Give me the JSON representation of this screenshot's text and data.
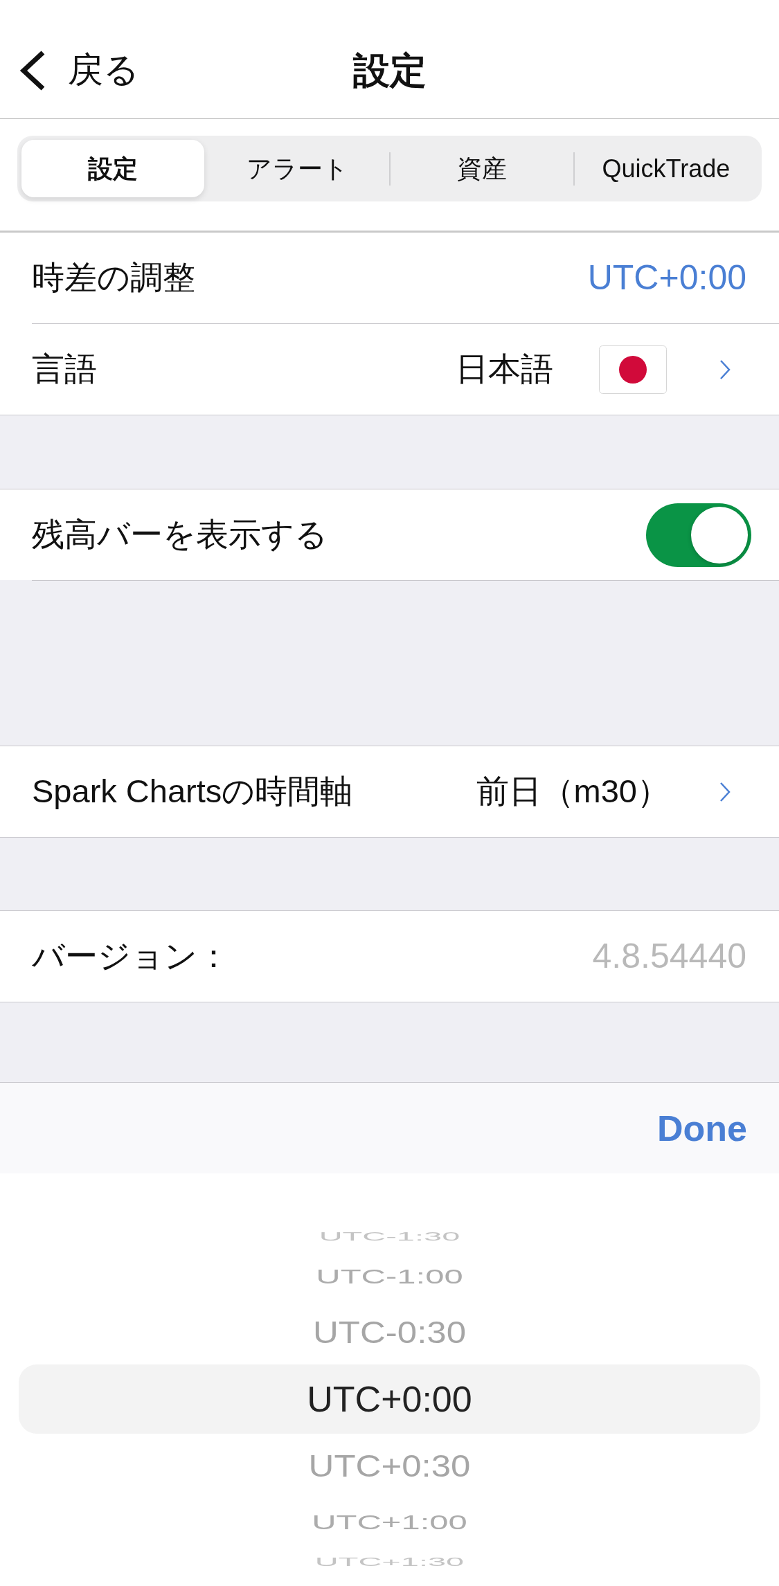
{
  "nav_bar": {
    "back_label": "戻る",
    "title": "設定"
  },
  "tabs": [
    {
      "label": "設定",
      "selected": true
    },
    {
      "label": "アラート",
      "selected": false
    },
    {
      "label": "資産",
      "selected": false
    },
    {
      "label": "QuickTrade",
      "selected": false
    }
  ],
  "sections": [
    {
      "rows": [
        {
          "kind": "value",
          "label": "時差の調整",
          "value": "UTC+0:00"
        },
        {
          "kind": "language",
          "label": "言語",
          "value": "日本語"
        }
      ]
    },
    {
      "rows": [
        {
          "kind": "toggle",
          "label": "残高バーを表示する",
          "on": true
        }
      ]
    },
    {
      "rows": [
        {
          "kind": "disclosure",
          "label": "Spark Chartsの時間軸",
          "value": "前日（m30）"
        }
      ]
    },
    {
      "rows": [
        {
          "kind": "info",
          "label": "バージョン：",
          "value": "4.8.54440"
        }
      ]
    }
  ],
  "picker": {
    "done_label": "Done",
    "options": [
      {
        "label": "UTC-1:30",
        "selected": false
      },
      {
        "label": "UTC-1:00",
        "selected": false
      },
      {
        "label": "UTC-0:30",
        "selected": false
      },
      {
        "label": "UTC+0:00",
        "selected": true
      },
      {
        "label": "UTC+0:30",
        "selected": false
      },
      {
        "label": "UTC+1:00",
        "selected": false
      },
      {
        "label": "UTC+1:30",
        "selected": false
      }
    ]
  }
}
